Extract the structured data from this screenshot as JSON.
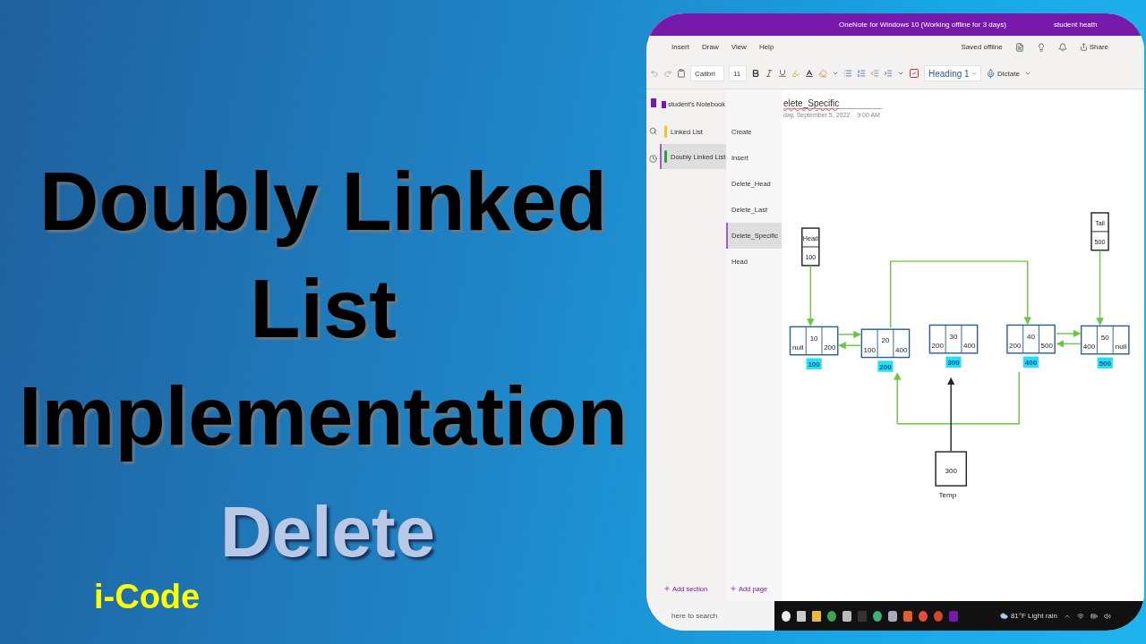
{
  "thumbnail": {
    "title_lines": [
      "Doubly Linked",
      "List",
      "Implementation"
    ],
    "subtitle": "Delete",
    "channel": "i-Code"
  },
  "app": {
    "window_title": "OneNote for Windows 10 (Working offline for 3 days)",
    "user": "student heath",
    "menu": [
      "Insert",
      "Draw",
      "View",
      "Help"
    ],
    "sync_status": "Saved offline",
    "share": "Share",
    "toolbar": {
      "font_name": "Calibri",
      "font_size": "11",
      "style": "Heading 1",
      "dictate": "Dictate"
    },
    "notebook": "student's Notebook",
    "sections": [
      {
        "name": "Linked List",
        "color": "#f2c12e",
        "selected": false
      },
      {
        "name": "Doubly Linked List",
        "color": "#2e9b4e",
        "selected": true
      }
    ],
    "pages": [
      {
        "name": "Create",
        "selected": false
      },
      {
        "name": "Insert",
        "selected": false
      },
      {
        "name": "Delete_Head",
        "selected": false
      },
      {
        "name": "Delete_Last",
        "selected": false
      },
      {
        "name": "Delete_Specific",
        "selected": true
      },
      {
        "name": "Head",
        "selected": false
      }
    ],
    "add_section": "Add section",
    "add_page": "Add page",
    "page": {
      "title": "elete_Specific",
      "date": "day, September 5, 2022",
      "time": "9:00 AM"
    },
    "diagram": {
      "head": {
        "label": "Head",
        "value": "100"
      },
      "tail": {
        "label": "Tail",
        "value": "500"
      },
      "nodes": [
        {
          "prev": "null",
          "data": "10",
          "next": "200",
          "address": "100"
        },
        {
          "prev": "100",
          "data": "20",
          "next": "400",
          "address": "200"
        },
        {
          "prev": "200",
          "data": "30",
          "next": "400",
          "address": "300"
        },
        {
          "prev": "200",
          "data": "40",
          "next": "500",
          "address": "400"
        },
        {
          "prev": "400",
          "data": "50",
          "next": "null",
          "address": "500"
        }
      ],
      "temp": {
        "value": "300",
        "label": "Temp"
      }
    }
  },
  "taskbar": {
    "search_placeholder": "here to search",
    "weather": "81°F Light rain"
  }
}
